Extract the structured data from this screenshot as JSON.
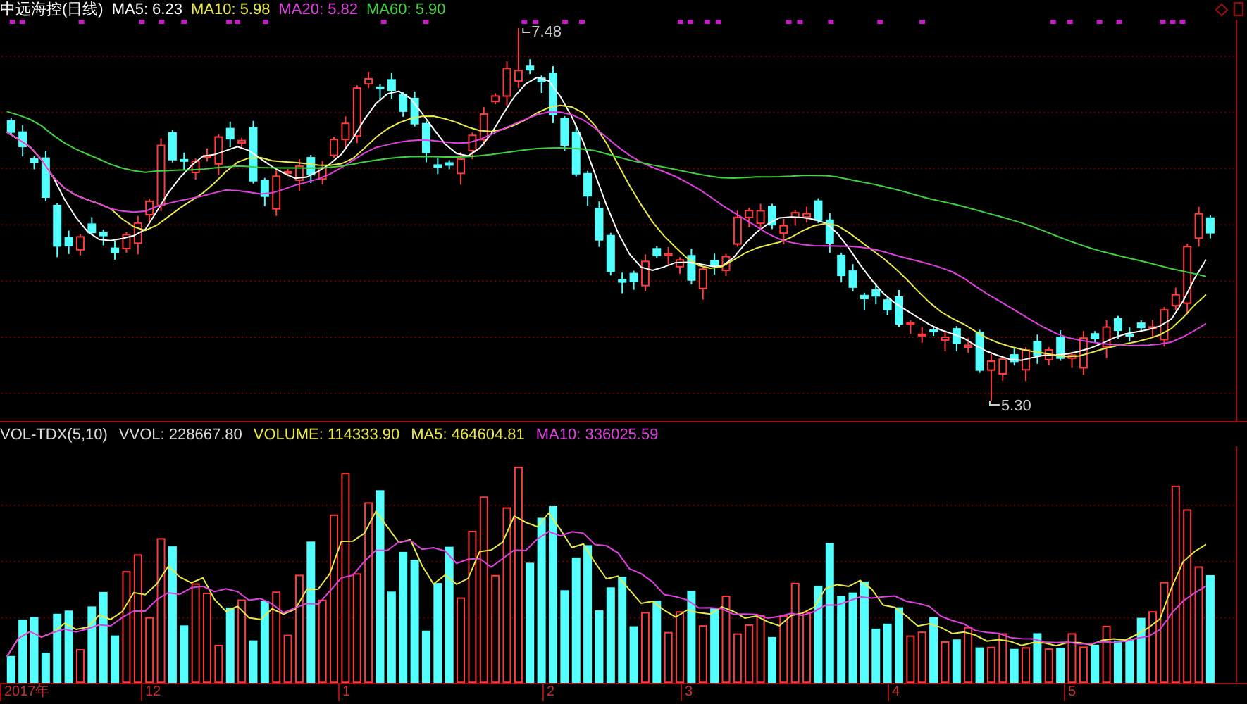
{
  "header": {
    "title": "中远海控(日线)",
    "indicators": [
      {
        "label": "MA5: 6.23",
        "color": "#ffffff"
      },
      {
        "label": "MA10: 5.98",
        "color": "#e8e84a"
      },
      {
        "label": "MA20: 5.82",
        "color": "#e040e0"
      },
      {
        "label": "MA60: 5.90",
        "color": "#40d040"
      }
    ]
  },
  "price_chart": {
    "high_label": "7.48",
    "low_label": "5.30"
  },
  "volume_panel": {
    "indicators": [
      {
        "label": "VOL-TDX(5,10)",
        "color": "#dddddd"
      },
      {
        "label": "VVOL: 228667.80",
        "color": "#dddddd"
      },
      {
        "label": "VOLUME: 114333.90",
        "color": "#e8e84a"
      },
      {
        "label": "MA5: 464604.81",
        "color": "#e8e84a"
      },
      {
        "label": "MA10: 336025.59",
        "color": "#e040e0"
      }
    ]
  },
  "time_axis": {
    "labels": [
      "2017年",
      "12",
      "1",
      "2",
      "3",
      "4",
      "5"
    ]
  }
}
